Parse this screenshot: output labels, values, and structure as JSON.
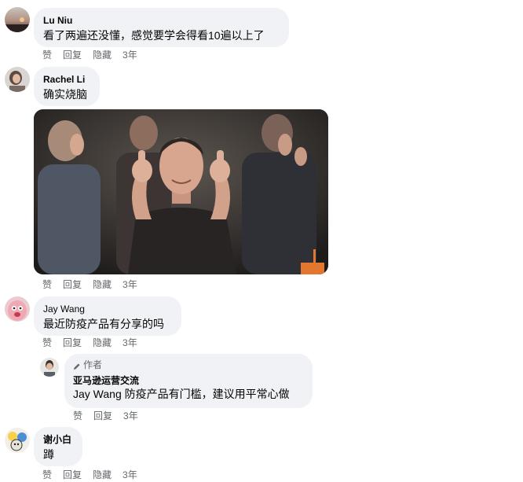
{
  "comments": [
    {
      "author": "Lu Niu",
      "text": "看了两遍还没懂，感觉要学会得看10遍以上了",
      "actions": {
        "like": "赞",
        "reply": "回复",
        "hide": "隐藏",
        "time": "3年"
      }
    },
    {
      "author": "Rachel Li",
      "text": "确实烧脑",
      "actions": {
        "like": "赞",
        "reply": "回复",
        "hide": "隐藏",
        "time": "3年"
      }
    },
    {
      "author": "Jay Wang",
      "text": "最近防疫产品有分享的吗",
      "actions": {
        "like": "赞",
        "reply": "回复",
        "hide": "隐藏",
        "time": "3年"
      }
    },
    {
      "author": "谢小白",
      "text": "蹲",
      "actions": {
        "like": "赞",
        "reply": "回复",
        "hide": "隐藏",
        "time": "3年"
      }
    }
  ],
  "reply": {
    "badge": "作者",
    "author": "亚马逊运营交流",
    "mention": "Jay Wang",
    "text": " 防疫产品有门槛，建议用平常心做",
    "actions": {
      "like": "赞",
      "reply": "回复",
      "time": "3年"
    }
  },
  "colors": {
    "bubble_bg": "#f0f2f5",
    "meta_text": "#65676b",
    "text": "#050505"
  }
}
